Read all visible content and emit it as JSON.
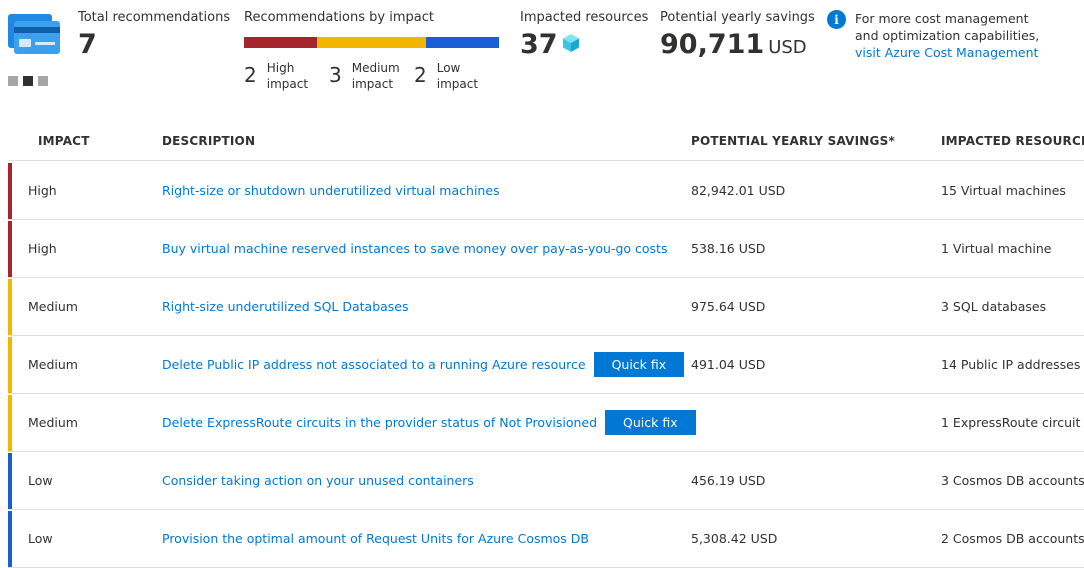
{
  "summary": {
    "total": {
      "label": "Total recommendations",
      "value": "7"
    },
    "by_impact": {
      "label": "Recommendations by impact",
      "bar_colors": {
        "high": "#a4262c",
        "medium": "#f2b600",
        "low": "#1a5ed6"
      },
      "bar_shares": {
        "high": 2,
        "medium": 3,
        "low": 2
      },
      "counts": [
        {
          "num": "2",
          "line1": "High",
          "line2": "impact"
        },
        {
          "num": "3",
          "line1": "Medium",
          "line2": "impact"
        },
        {
          "num": "2",
          "line1": "Low",
          "line2": "impact"
        }
      ]
    },
    "impacted": {
      "label": "Impacted resources",
      "value": "37",
      "icon": "cube-icon"
    },
    "savings": {
      "label": "Potential yearly savings",
      "value": "90,711",
      "unit": "USD"
    },
    "info": {
      "line1": "For more cost management",
      "line2": "and optimization capabilities,",
      "link": "visit Azure Cost Management"
    },
    "pager": {
      "pages": 3,
      "active": 2
    }
  },
  "table": {
    "headers": {
      "impact": "IMPACT",
      "description": "DESCRIPTION",
      "savings": "POTENTIAL YEARLY SAVINGS*",
      "resources": "IMPACTED RESOURCES"
    },
    "quick_fix_label": "Quick fix",
    "impact_colors": {
      "High": "#a4262c",
      "Medium": "#f2b600",
      "Low": "#1a5ed6"
    },
    "rows": [
      {
        "impact": "High",
        "description": "Right-size or shutdown underutilized virtual machines",
        "savings": "82,942.01 USD",
        "resources": "15 Virtual machines",
        "quick_fix": false
      },
      {
        "impact": "High",
        "description": "Buy virtual machine reserved instances to save money over pay-as-you-go costs",
        "savings": "538.16 USD",
        "resources": "1 Virtual machine",
        "quick_fix": false
      },
      {
        "impact": "Medium",
        "description": "Right-size underutilized SQL Databases",
        "savings": "975.64 USD",
        "resources": "3 SQL databases",
        "quick_fix": false
      },
      {
        "impact": "Medium",
        "description": "Delete Public IP address not associated to a running Azure resource",
        "savings": "491.04 USD",
        "resources": "14 Public IP addresses",
        "quick_fix": true
      },
      {
        "impact": "Medium",
        "description": "Delete ExpressRoute circuits in the provider status of Not Provisioned",
        "savings": "",
        "resources": "1 ExpressRoute circuit",
        "quick_fix": true
      },
      {
        "impact": "Low",
        "description": "Consider taking action on your unused containers",
        "savings": "456.19 USD",
        "resources": "3 Cosmos DB accounts",
        "quick_fix": false
      },
      {
        "impact": "Low",
        "description": "Provision the optimal amount of Request Units for Azure Cosmos DB",
        "savings": "5,308.42 USD",
        "resources": "2 Cosmos DB accounts",
        "quick_fix": false
      }
    ]
  }
}
